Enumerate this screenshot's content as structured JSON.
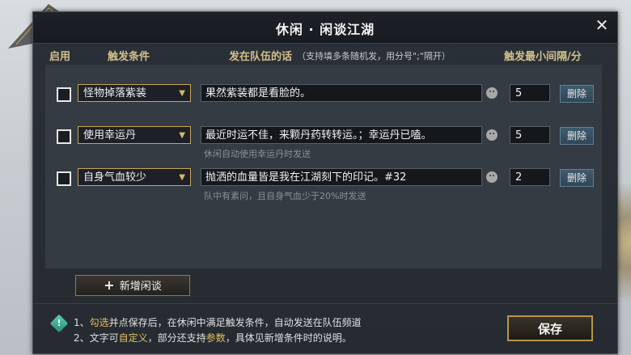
{
  "window": {
    "title": "休闲 · 闲谈江湖"
  },
  "headers": {
    "enable": "启用",
    "trigger": "触发条件",
    "message": "发在队伍的话",
    "message_note": "（支持填多条随机发，用分号\";\"隔开）",
    "interval": "触发最小间隔/分"
  },
  "rows": [
    {
      "trigger": "怪物掉落紫装",
      "message": "果然紫装都是看脸的。",
      "hint": "",
      "interval": "5",
      "delete_label": "删除",
      "checked": false
    },
    {
      "trigger": "使用幸运丹",
      "message": "最近时运不佳，来颗丹药转转运。；幸运丹已嗑。",
      "hint": "休闲自动使用幸运丹时发送",
      "interval": "5",
      "delete_label": "删除",
      "checked": false
    },
    {
      "trigger": "自身气血较少",
      "message": "抛洒的血量皆是我在江湖刻下的印记。#32",
      "hint": "队中有素问，且自身气血少于20%时发送",
      "interval": "2",
      "delete_label": "删除",
      "checked": false
    }
  ],
  "add_button": {
    "label": "新增闲谈"
  },
  "tips": {
    "line1_a": "1、",
    "line1_hl": "勾选",
    "line1_b": "并点保存后，在休闲中满足触发条件，自动发送在队伍频道",
    "line2_a": "2、文字可",
    "line2_hl1": "自定义",
    "line2_b": "，部分还支持",
    "line2_hl2": "参数",
    "line2_c": "，具体见新增条件时的说明。"
  },
  "save_button": {
    "label": "保存"
  },
  "colors": {
    "accent_gold": "#c8a45a",
    "highlight": "#e5c263",
    "delete_blue": "#3e5b6e"
  }
}
